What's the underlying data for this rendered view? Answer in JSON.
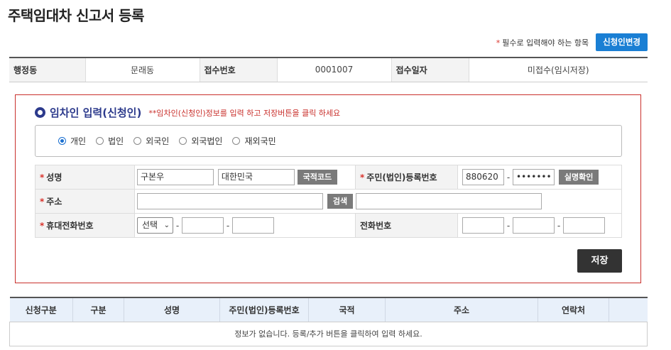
{
  "page": {
    "title": "주택임대차 신고서 등록"
  },
  "top": {
    "required_star": "*",
    "required_note": "필수로 입력해야 하는 항목",
    "change_applicant_label": "신청인변경"
  },
  "info": {
    "district_label": "행정동",
    "district_value": "문래동",
    "receipt_no_label": "접수번호",
    "receipt_no_value": "0001007",
    "receipt_date_label": "접수일자",
    "receipt_date_value": "미접수(임시저장)"
  },
  "panel": {
    "title": "임차인 입력(신청인)",
    "hint_prefix": "**",
    "hint": "임차인(신청인)정보를 입력 하고 저장버튼을 클릭 하세요",
    "types": [
      {
        "label": "개인",
        "selected": true
      },
      {
        "label": "법인",
        "selected": false
      },
      {
        "label": "외국인",
        "selected": false
      },
      {
        "label": "외국법인",
        "selected": false
      },
      {
        "label": "재외국민",
        "selected": false
      }
    ],
    "form": {
      "name_label": "성명",
      "name_value": "구본우",
      "nationality_value": "대한민국",
      "nationality_btn": "국적코드",
      "idno_label": "주민(법인)등록번호",
      "idno_front": "880620",
      "idno_back": "•••••••",
      "verify_btn": "실명확인",
      "address_label": "주소",
      "address_value": "",
      "search_btn": "검색",
      "address_detail": "",
      "mobile_label": "휴대전화번호",
      "mobile_select": "선택",
      "mobile_mid": "",
      "mobile_last": "",
      "phone_label": "전화번호",
      "phone_1": "",
      "phone_2": "",
      "phone_3": "",
      "dash": "-",
      "star": "*"
    },
    "save_label": "저장"
  },
  "list": {
    "headers": [
      "신청구분",
      "구분",
      "성명",
      "주민(법인)등록번호",
      "국적",
      "주소",
      "연락처",
      ""
    ],
    "empty_message": "정보가 없습니다.   등록/추가 버튼을 클릭하여 입력 하세요."
  }
}
